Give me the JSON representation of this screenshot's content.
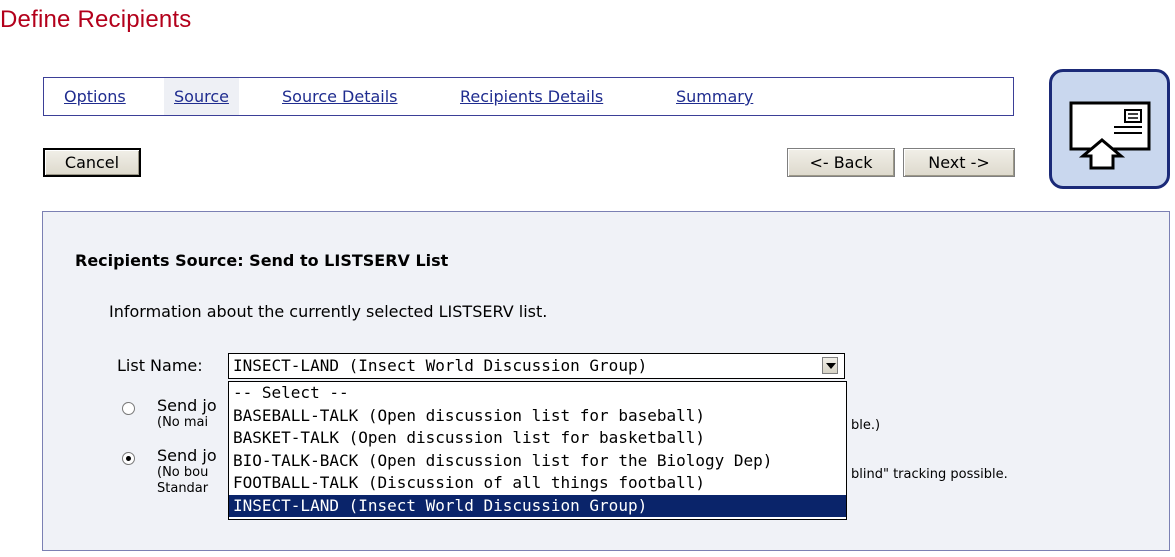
{
  "page": {
    "title": "Define Recipients"
  },
  "tabs": [
    {
      "label": "Options"
    },
    {
      "label": "Source"
    },
    {
      "label": "Source Details"
    },
    {
      "label": "Recipients Details"
    },
    {
      "label": "Summary"
    }
  ],
  "buttons": {
    "cancel": "Cancel",
    "back": "<- Back",
    "next": "Next ->"
  },
  "panel": {
    "heading": "Recipients Source: Send to LISTSERV List",
    "info": "Information about the currently selected LISTSERV list.",
    "list_name_label": "List Name:",
    "list_value": "INSECT-LAND (Insect World Discussion Group)",
    "options": [
      "-- Select --",
      "BASEBALL-TALK (Open discussion list for baseball)",
      "BASKET-TALK (Open discussion list for basketball)",
      "BIO-TALK-BACK (Open discussion list for the Biology Dep)",
      "FOOTBALL-TALK (Discussion of all things football)",
      "INSECT-LAND (Insect World Discussion Group)"
    ],
    "radio1": {
      "label": "Send jo",
      "note": "(No mai",
      "note_end": "ble.)"
    },
    "radio2": {
      "label": "Send jo",
      "note": "(No bou",
      "note2": "Standar",
      "note_end": "blind\" tracking possible."
    }
  },
  "colors": {
    "title": "#b3001b",
    "link": "#1f2c8f",
    "border": "#3b3f97",
    "selection": "#0a246a"
  },
  "icons": {
    "wizard": "mail-send-icon"
  }
}
